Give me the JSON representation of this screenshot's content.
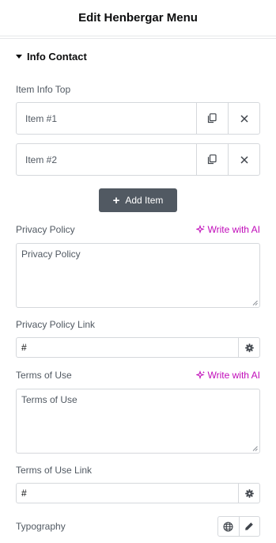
{
  "header": {
    "title": "Edit Henbergar Menu"
  },
  "section": {
    "title": "Info Contact"
  },
  "repeater": {
    "label": "Item Info Top",
    "items": [
      {
        "title": "Item #1"
      },
      {
        "title": "Item #2"
      }
    ],
    "add_label": "Add Item"
  },
  "privacy_policy": {
    "label": "Privacy Policy",
    "ai_label": "Write with AI",
    "value": "Privacy Policy"
  },
  "privacy_policy_link": {
    "label": "Privacy Policy Link",
    "value": "#"
  },
  "terms_of_use": {
    "label": "Terms of Use",
    "ai_label": "Write with AI",
    "value": "Terms of Use"
  },
  "terms_of_use_link": {
    "label": "Terms of Use Link",
    "value": "#"
  },
  "typography": {
    "label": "Typography"
  },
  "colors": {
    "ai": "#c00bb9",
    "button": "#515962",
    "border": "#d5d8dc"
  }
}
